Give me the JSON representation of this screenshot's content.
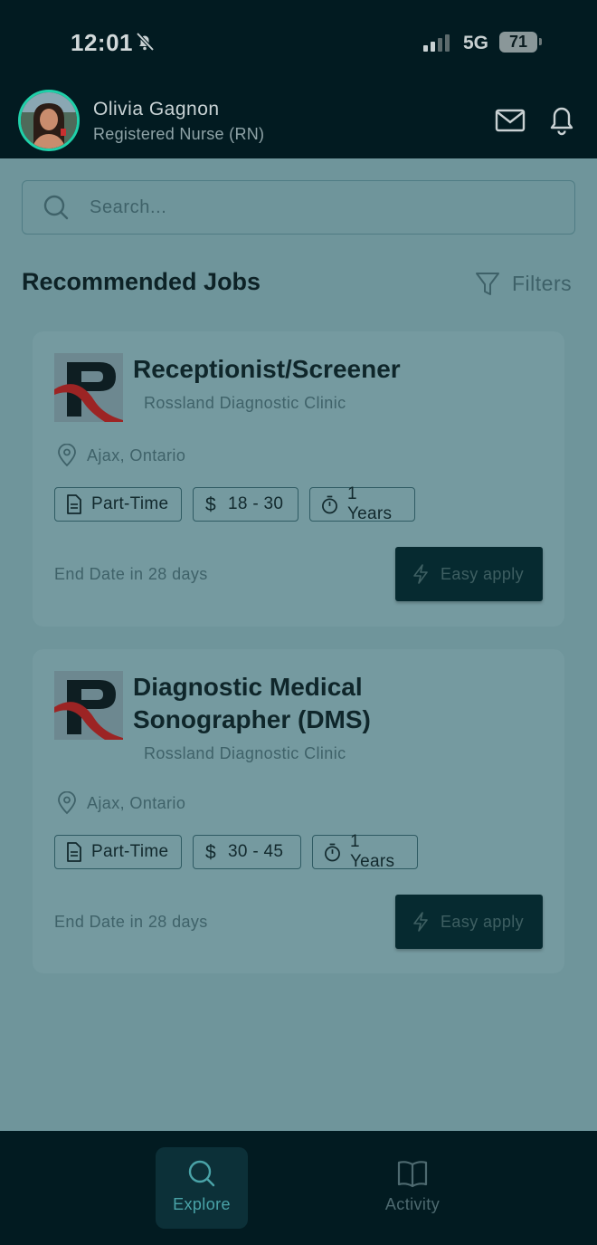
{
  "status_bar": {
    "time": "12:01",
    "network": "5G",
    "battery": "71"
  },
  "header": {
    "name": "Olivia Gagnon",
    "role": "Registered Nurse (RN)"
  },
  "search": {
    "placeholder": "Search..."
  },
  "section": {
    "title": "Recommended Jobs",
    "filters_label": "Filters"
  },
  "jobs": [
    {
      "title_lines": [
        "Receptionist/Screener"
      ],
      "clinic": "Rossland Diagnostic Clinic",
      "location": "Ajax, Ontario",
      "type": "Part-Time",
      "pay": "18 - 30",
      "experience": "1 Years",
      "end_date": "End Date in 28 days",
      "apply_label": "Easy apply"
    },
    {
      "title_lines": [
        "Diagnostic Medical",
        "Sonographer (DMS)"
      ],
      "clinic": "Rossland Diagnostic Clinic",
      "location": "Ajax, Ontario",
      "type": "Part-Time",
      "pay": "30 - 45",
      "experience": "1 Years",
      "end_date": "End Date in 28 days",
      "apply_label": "Easy apply"
    }
  ],
  "nav": {
    "explore": "Explore",
    "activity": "Activity"
  },
  "colors": {
    "accent": "#1fd0a9",
    "header_bg": "#021b21",
    "overlay_bg": "#6f959b",
    "apply_bg": "#062a30"
  }
}
